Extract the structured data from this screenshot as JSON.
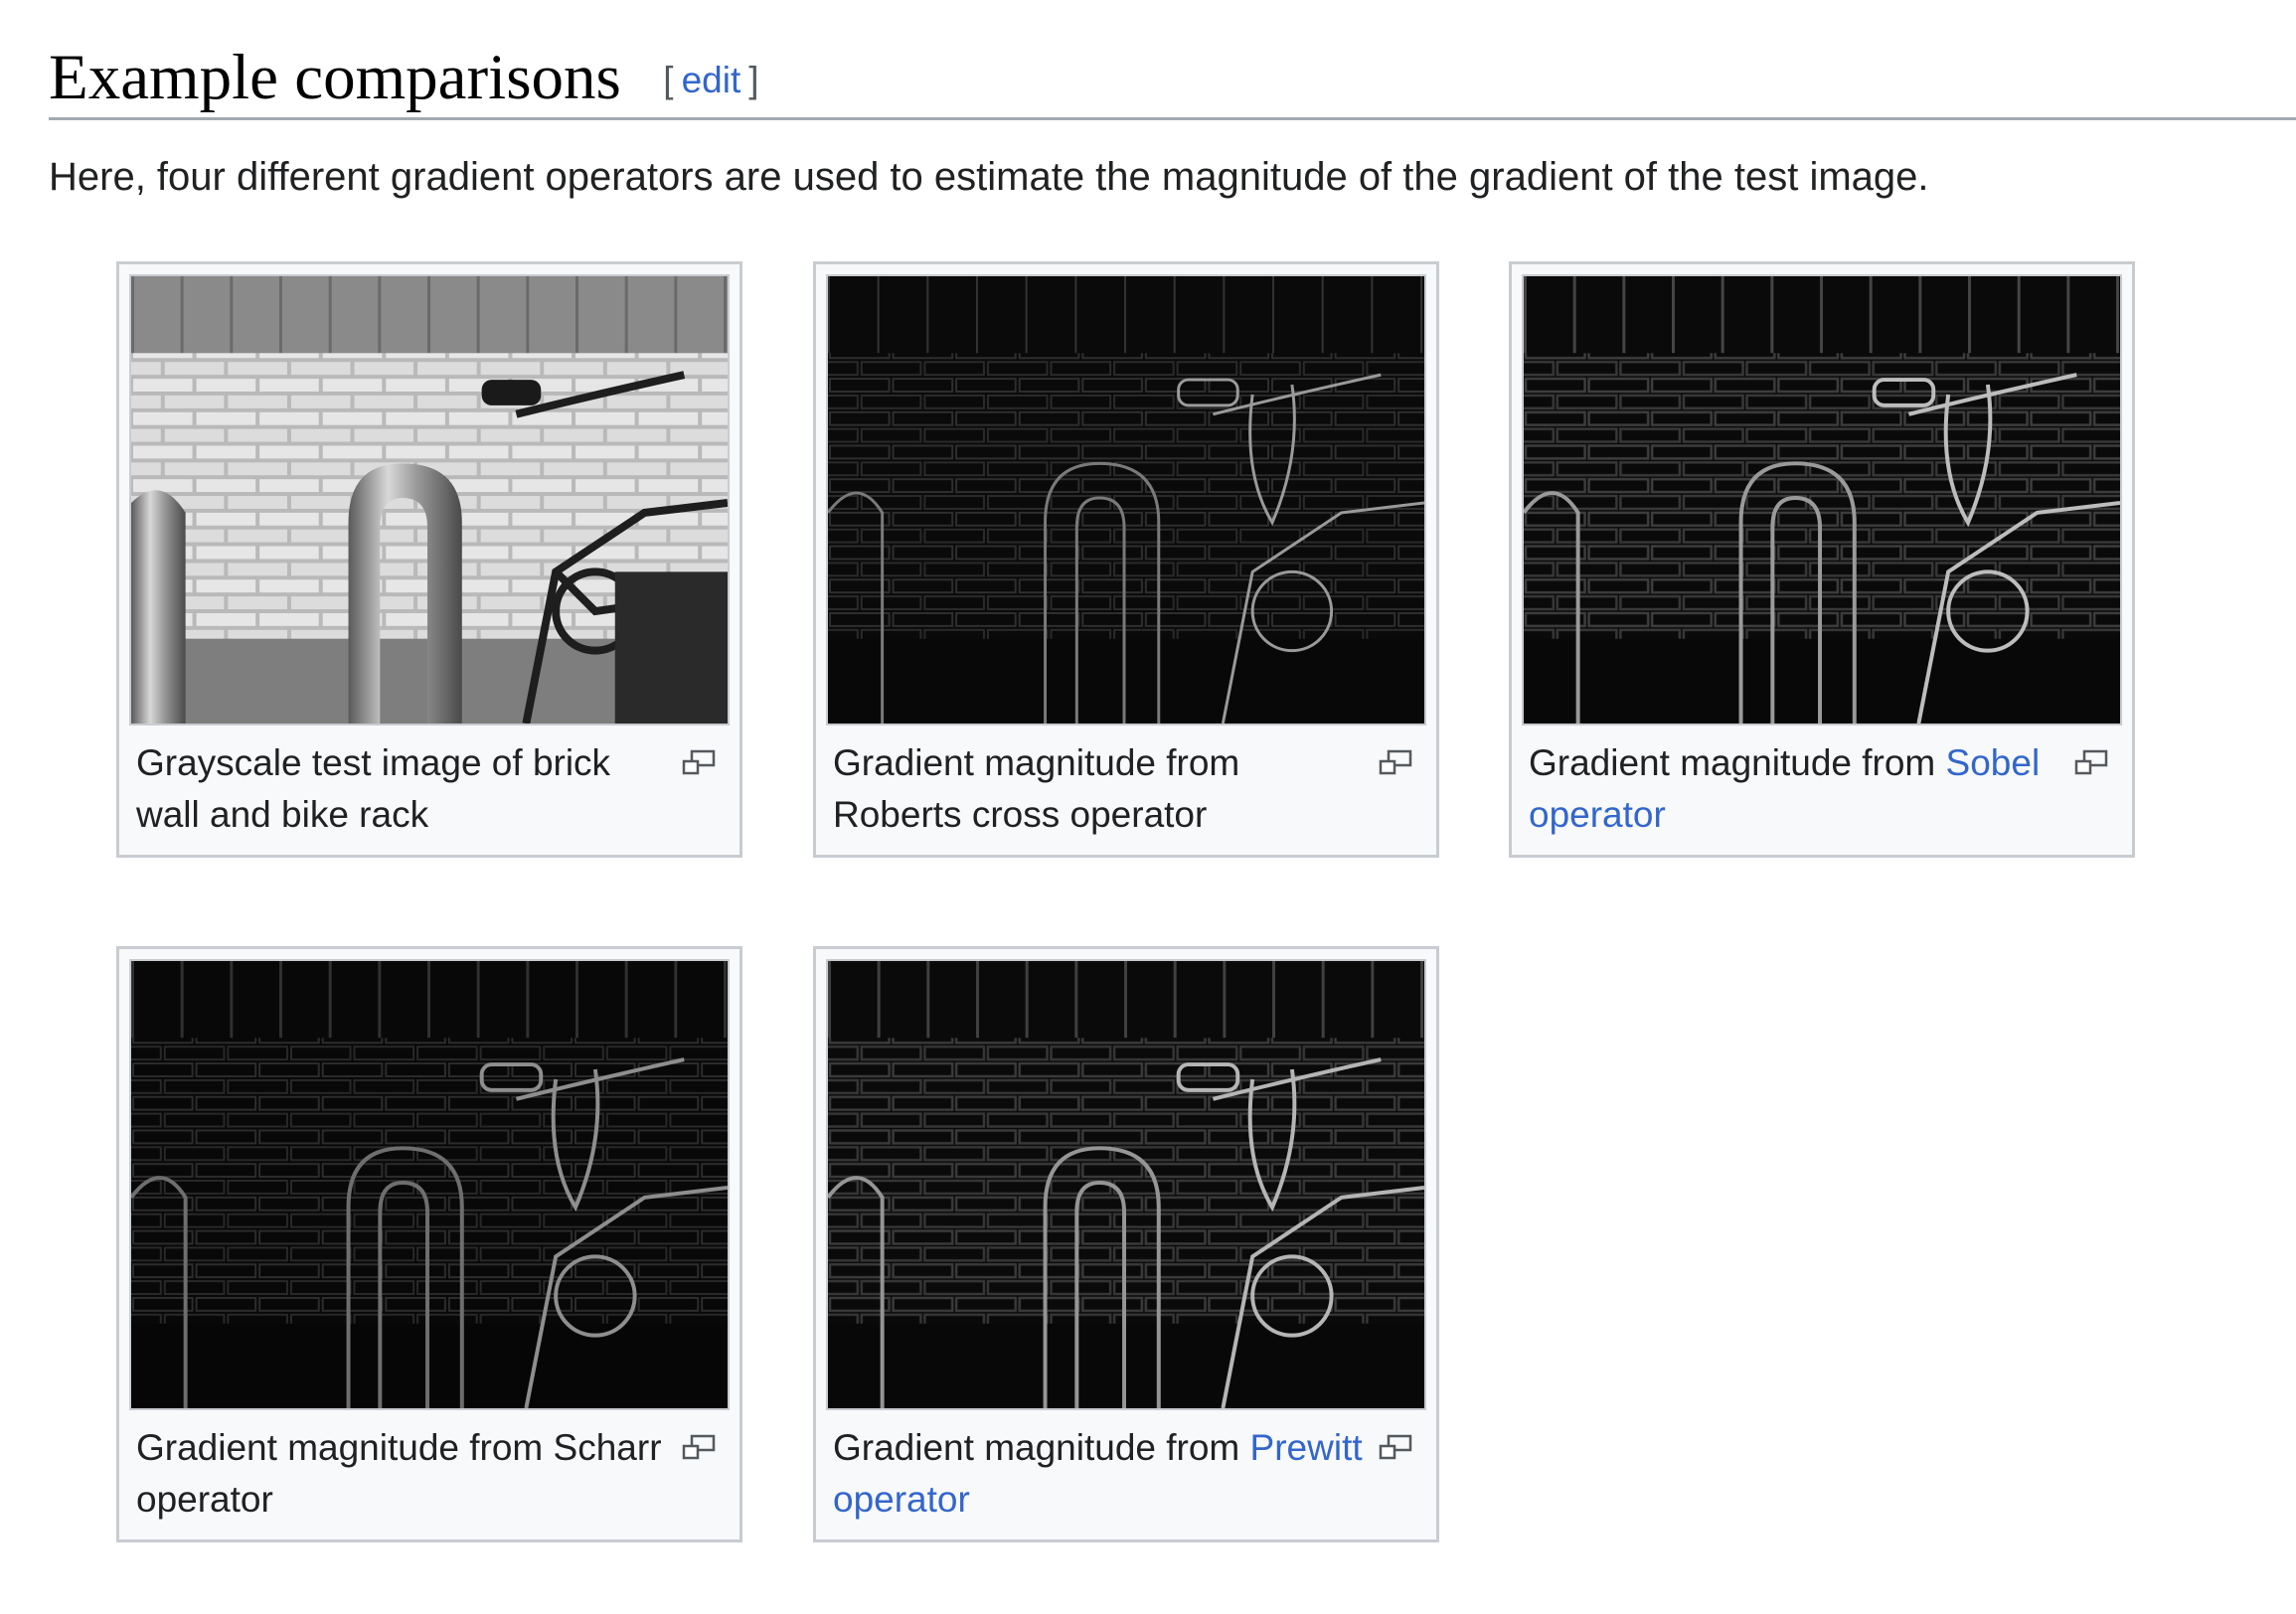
{
  "section": {
    "heading": "Example comparisons",
    "edit_open": "[",
    "edit_label": "edit",
    "edit_close": "]",
    "intro": "Here, four different gradient operators are used to estimate the magnitude of the gradient of the test image."
  },
  "gallery": [
    {
      "image_kind": "grayscale-photo",
      "icon": "magnify-icon",
      "caption_text": "Grayscale test image of brick wall and bike rack",
      "caption_link": ""
    },
    {
      "image_kind": "gradient-magnitude",
      "icon": "magnify-icon",
      "caption_text": "Gradient magnitude from Roberts cross operator",
      "caption_link": ""
    },
    {
      "image_kind": "gradient-magnitude",
      "icon": "magnify-icon",
      "caption_text": "Gradient magnitude from ",
      "caption_link": "Sobel operator"
    },
    {
      "image_kind": "gradient-magnitude",
      "icon": "magnify-icon",
      "caption_text": "Gradient magnitude from Scharr operator",
      "caption_link": ""
    },
    {
      "image_kind": "gradient-magnitude",
      "icon": "magnify-icon",
      "caption_text": "Gradient magnitude from ",
      "caption_link": "Prewitt operator"
    }
  ],
  "colors": {
    "link": "#3366cc",
    "text": "#202122",
    "border": "#c8ccd1",
    "box_background": "#f8f9fa",
    "rule": "#a2a9b1"
  }
}
